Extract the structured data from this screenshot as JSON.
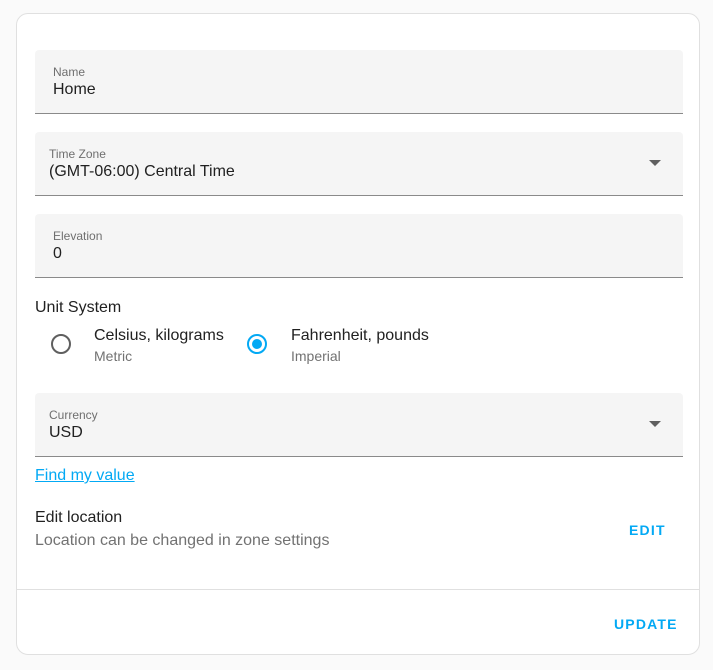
{
  "form": {
    "name": {
      "label": "Name",
      "value": "Home"
    },
    "time_zone": {
      "label": "Time Zone",
      "value": "(GMT-06:00) Central Time"
    },
    "elevation": {
      "label": "Elevation",
      "value": "0"
    },
    "unit_system": {
      "label": "Unit System",
      "options": [
        {
          "title": "Celsius, kilograms",
          "subtitle": "Metric",
          "selected": false
        },
        {
          "title": "Fahrenheit, pounds",
          "subtitle": "Imperial",
          "selected": true
        }
      ]
    },
    "currency": {
      "label": "Currency",
      "value": "USD"
    },
    "find_value_link": "Find my value",
    "location": {
      "title": "Edit location",
      "subtitle": "Location can be changed in zone settings",
      "edit_label": "EDIT"
    }
  },
  "footer": {
    "update_label": "UPDATE"
  },
  "colors": {
    "accent": "#03a9f4",
    "field_bg": "#f5f5f5"
  }
}
